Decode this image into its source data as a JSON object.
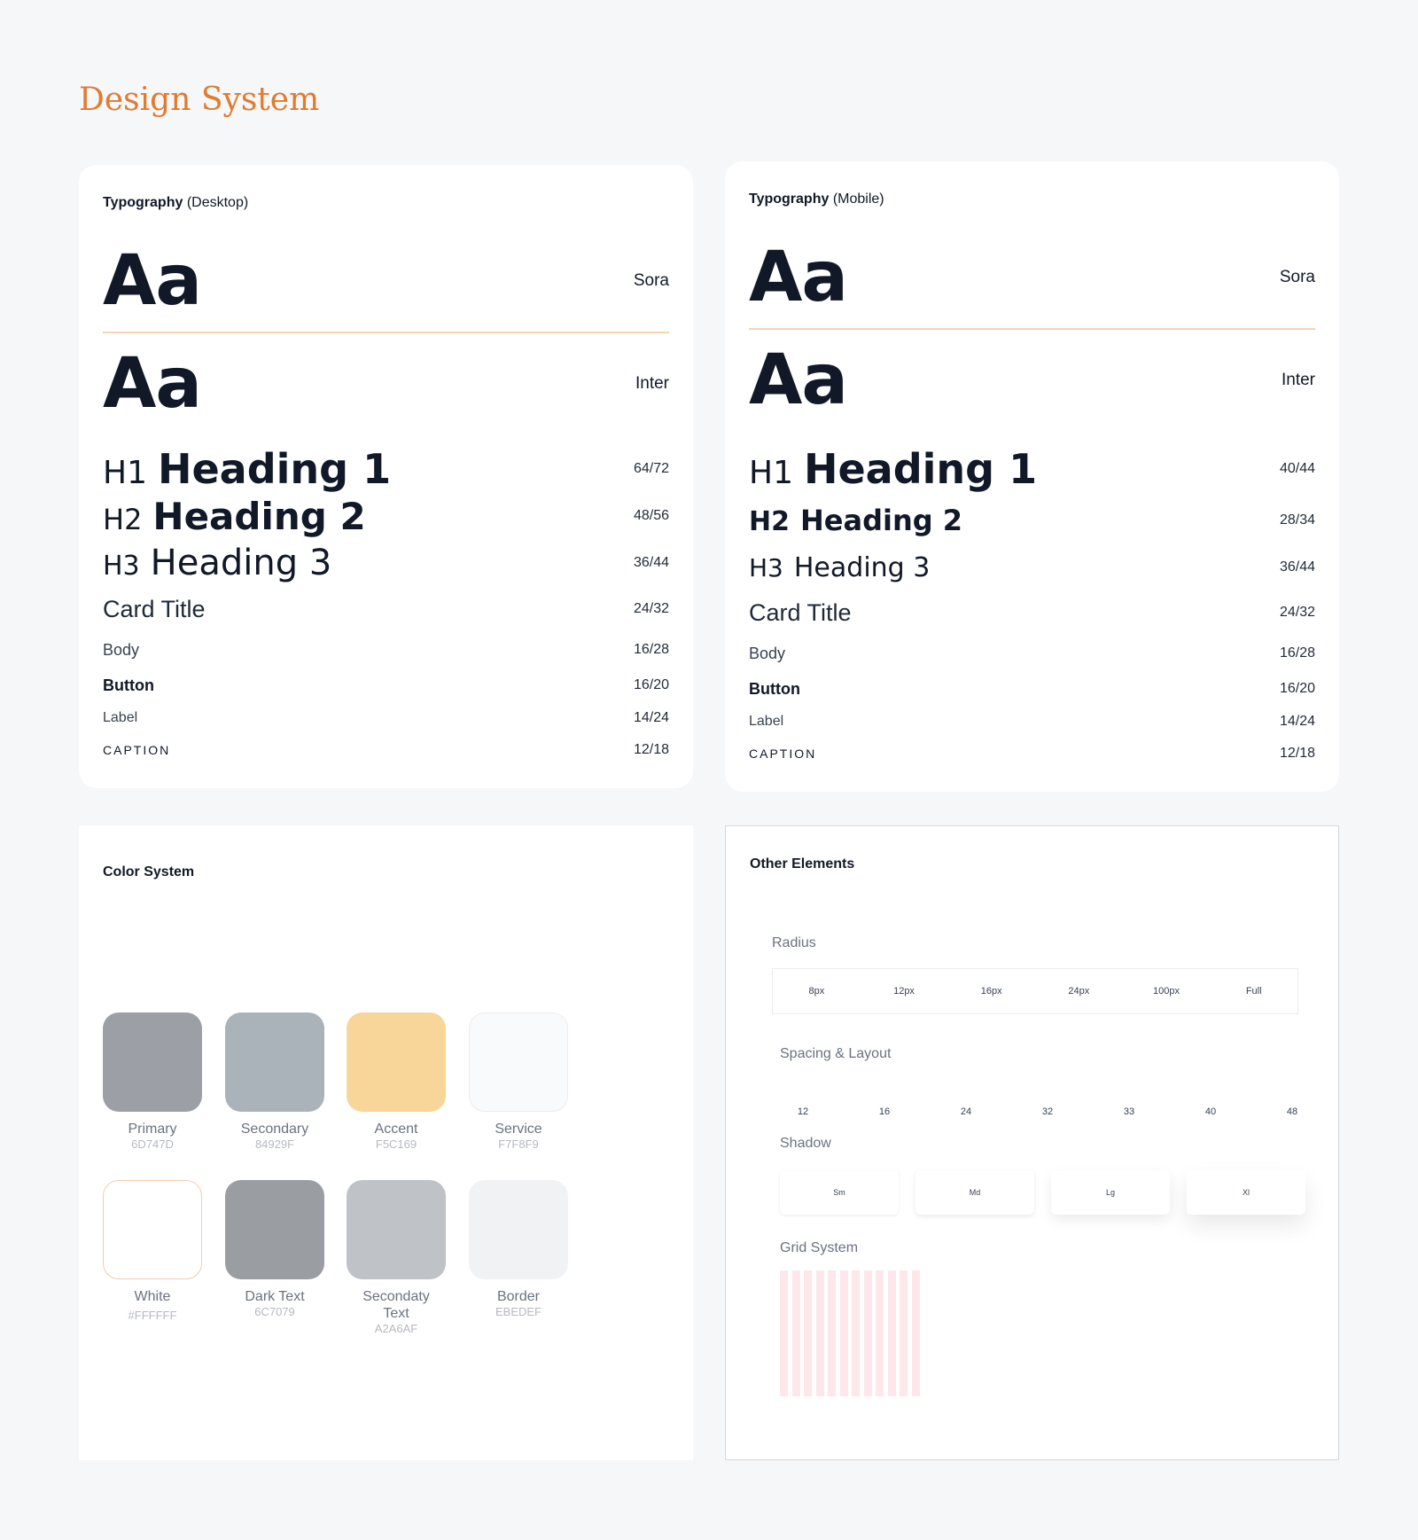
{
  "page": {
    "title": "Design System"
  },
  "typography_desktop": {
    "label_bold": "Typography",
    "label_rest": "(Desktop)",
    "sample": "Aa",
    "font_primary": "Sora",
    "font_secondary": "Inter",
    "styles": [
      {
        "tag": "H1",
        "text": "Heading 1",
        "value": "64/72"
      },
      {
        "tag": "H2",
        "text": "Heading 2",
        "value": "48/56"
      },
      {
        "tag": "H3",
        "text": "Heading 3",
        "value": "36/44"
      },
      {
        "text": "Card Title",
        "value": "24/32"
      },
      {
        "text": "Body",
        "value": "16/28"
      },
      {
        "text": "Button",
        "value": "16/20"
      },
      {
        "text": "Label",
        "value": "14/24"
      },
      {
        "text": "CAPTION",
        "value": "12/18"
      }
    ]
  },
  "typography_mobile": {
    "label_bold": "Typography",
    "label_rest": "(Mobile)",
    "sample": "Aa",
    "font_primary": "Sora",
    "font_secondary": "Inter",
    "styles": [
      {
        "tag": "H1",
        "text": "Heading 1",
        "value": "40/44"
      },
      {
        "tag": "H2",
        "text": "Heading 2",
        "value": "28/34"
      },
      {
        "tag": "H3",
        "text": "Heading 3",
        "value": "36/44"
      },
      {
        "text": "Card Title",
        "value": "24/32"
      },
      {
        "text": "Body",
        "value": "16/28"
      },
      {
        "text": "Button",
        "value": "16/20"
      },
      {
        "text": "Label",
        "value": "14/24"
      },
      {
        "text": "CAPTION",
        "value": "12/18"
      }
    ]
  },
  "color_system": {
    "label": "Color System",
    "swatches": [
      {
        "name": "Primary",
        "hex": "6D747D",
        "color": "#9CA0A6"
      },
      {
        "name": "Secondary",
        "hex": "84929F",
        "color": "#ABB3BA"
      },
      {
        "name": "Accent",
        "hex": "F5C169",
        "color": "#F8D598"
      },
      {
        "name": "Service",
        "hex": "F7F8F9",
        "color": "#F9FAFB"
      },
      {
        "name": "White",
        "hex": "#FFFFFF",
        "color": "#FFFFFF"
      },
      {
        "name": "Dark Text",
        "hex": "6C7079",
        "color": "#9A9DA2"
      },
      {
        "name": "Secondaty Text",
        "hex": "A2A6AF",
        "color": "#BFC3C8"
      },
      {
        "name": "Border",
        "hex": "EBEDEF",
        "color": "#F1F2F3"
      }
    ]
  },
  "other_elements": {
    "label": "Other Elements",
    "radius": {
      "label": "Radius",
      "items": [
        "8px",
        "12px",
        "16px",
        "24px",
        "100px",
        "Full"
      ]
    },
    "spacing": {
      "label": "Spacing & Layout",
      "items": [
        "12",
        "16",
        "24",
        "32",
        "33",
        "40",
        "48"
      ]
    },
    "shadow": {
      "label": "Shadow",
      "items": [
        "Sm",
        "Md",
        "Lg",
        "Xl"
      ]
    },
    "grid": {
      "label": "Grid System",
      "columns": 12,
      "color": "#FDE7EA"
    }
  }
}
